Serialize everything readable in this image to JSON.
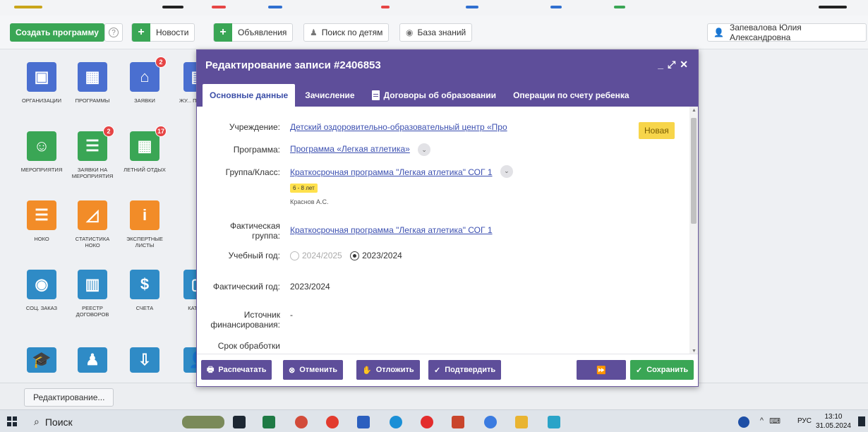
{
  "toolbar": {
    "create_program": "Создать программу",
    "news": "Новости",
    "announcements": "Объявления",
    "children_search": "Поиск по детям",
    "knowledge_base": "База знаний",
    "user_name": "Запевалова Юлия Александровна"
  },
  "tiles": [
    {
      "label": "Организации",
      "color": "#4a6fd0",
      "icon": "briefcase-icon"
    },
    {
      "label": "Программы",
      "color": "#4a6fd0",
      "icon": "calendar-icon"
    },
    {
      "label": "Заявки",
      "color": "#4a6fd0",
      "icon": "basket-icon",
      "badge": "2"
    },
    {
      "label": "Жу... посещ...",
      "color": "#4a6fd0",
      "icon": "journal-icon"
    },
    {
      "label": "Мероприятия",
      "color": "#3aa655",
      "icon": "smile-icon"
    },
    {
      "label": "Заявки на мероприятия",
      "color": "#3aa655",
      "icon": "list-icon",
      "badge": "2"
    },
    {
      "label": "Летний отдых",
      "color": "#3aa655",
      "icon": "calendar-icon",
      "badge": "17"
    },
    {
      "label": "НОКО",
      "color": "#f28c28",
      "icon": "list-icon"
    },
    {
      "label": "Статистика НОКО",
      "color": "#f28c28",
      "icon": "chart-icon"
    },
    {
      "label": "Экспертные листы",
      "color": "#f28c28",
      "icon": "info-icon"
    },
    {
      "label": "Соц. заказ",
      "color": "#2f8bc6",
      "icon": "doc-person-icon"
    },
    {
      "label": "Реестр договоров",
      "color": "#2f8bc6",
      "icon": "doc-chart-icon"
    },
    {
      "label": "Счета",
      "color": "#2f8bc6",
      "icon": "doc-dollar-icon"
    },
    {
      "label": "Катал...",
      "color": "#2f8bc6",
      "icon": "doc-icon"
    }
  ],
  "modal": {
    "title": "Редактирование записи #2406853",
    "tabs": [
      "Основные данные",
      "Зачисление",
      "Договоры об образовании",
      "Операции по счету ребенка"
    ],
    "status": "Новая",
    "fields": {
      "institution_label": "Учреждение:",
      "institution_value": "Детский оздоровительно-образовательный центр «Про",
      "program_label": "Программа:",
      "program_value": "Программа «Легкая атлетика»",
      "group_label": "Группа/Класс:",
      "group_value": "Краткосрочная программа \"Легкая атлетика\" СОГ 1",
      "age": "6 - 8 лет",
      "teacher": "Краснов А.С.",
      "actual_group_label": "Фактическая группа:",
      "actual_group_value": "Краткосрочная программа \"Легкая атлетика\" СОГ 1",
      "year_label": "Учебный год:",
      "year_opt1": "2024/2025",
      "year_opt2": "2023/2024",
      "actual_year_label": "Фактический год:",
      "actual_year_value": "2023/2024",
      "funding_label": "Источник финансирования:",
      "funding_value": "-",
      "deadline_label": "Срок обработки"
    },
    "footer": {
      "print": "Распечатать",
      "cancel": "Отменить",
      "postpone": "Отложить",
      "confirm": "Подтвердить",
      "skip": "⏩",
      "save": "Сохранить"
    }
  },
  "taskline": {
    "item": "Редактирование..."
  },
  "taskbar": {
    "search": "Поиск",
    "lang": "РУС",
    "time": "13:10",
    "date": "31.05.2024"
  }
}
